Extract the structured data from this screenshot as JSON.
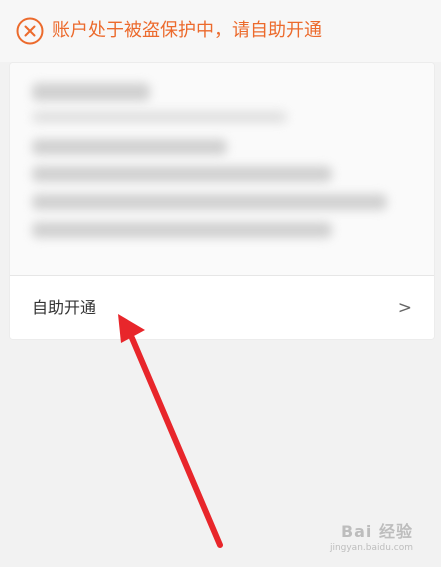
{
  "alert": {
    "icon": "close-circle-icon",
    "text": "账户处于被盗保护中，请自助开通",
    "color": "#ec6a2c"
  },
  "card": {
    "action_label": "自助开通",
    "chevron": ">"
  },
  "annotation": {
    "arrow_color": "#e8262b"
  },
  "watermark": {
    "logo": "Bai 经验",
    "url": "jingyan.baidu.com"
  }
}
